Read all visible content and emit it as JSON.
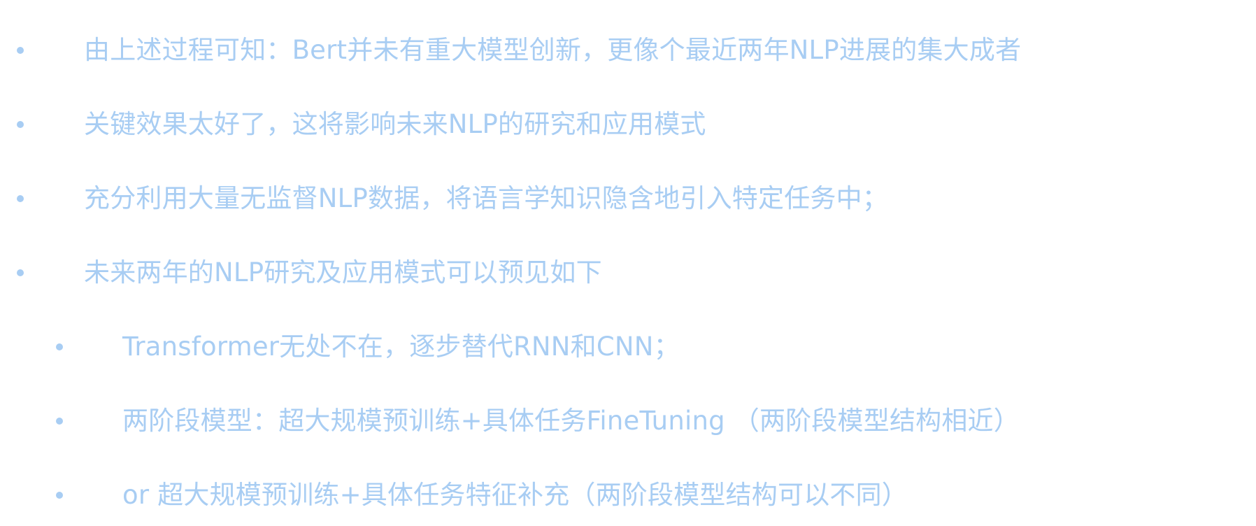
{
  "bullets": [
    {
      "level": 1,
      "text": "由上述过程可知：Bert并未有重大模型创新，更像个最近两年NLP进展的集大成者"
    },
    {
      "level": 1,
      "text": "关键效果太好了，这将影响未来NLP的研究和应用模式"
    },
    {
      "level": 1,
      "text": "充分利用大量无监督NLP数据，将语言学知识隐含地引入特定任务中；"
    },
    {
      "level": 1,
      "text": "未来两年的NLP研究及应用模式可以预见如下"
    },
    {
      "level": 2,
      "text": "Transformer无处不在，逐步替代RNN和CNN；"
    },
    {
      "level": 2,
      "text": "两阶段模型：超大规模预训练+具体任务FineTuning （两阶段模型结构相近）"
    },
    {
      "level": 2,
      "text": " or 超大规模预训练+具体任务特征补充（两阶段模型结构可以不同）"
    }
  ],
  "colors": {
    "text": "#a8cdf3",
    "background": "#ffffff"
  }
}
